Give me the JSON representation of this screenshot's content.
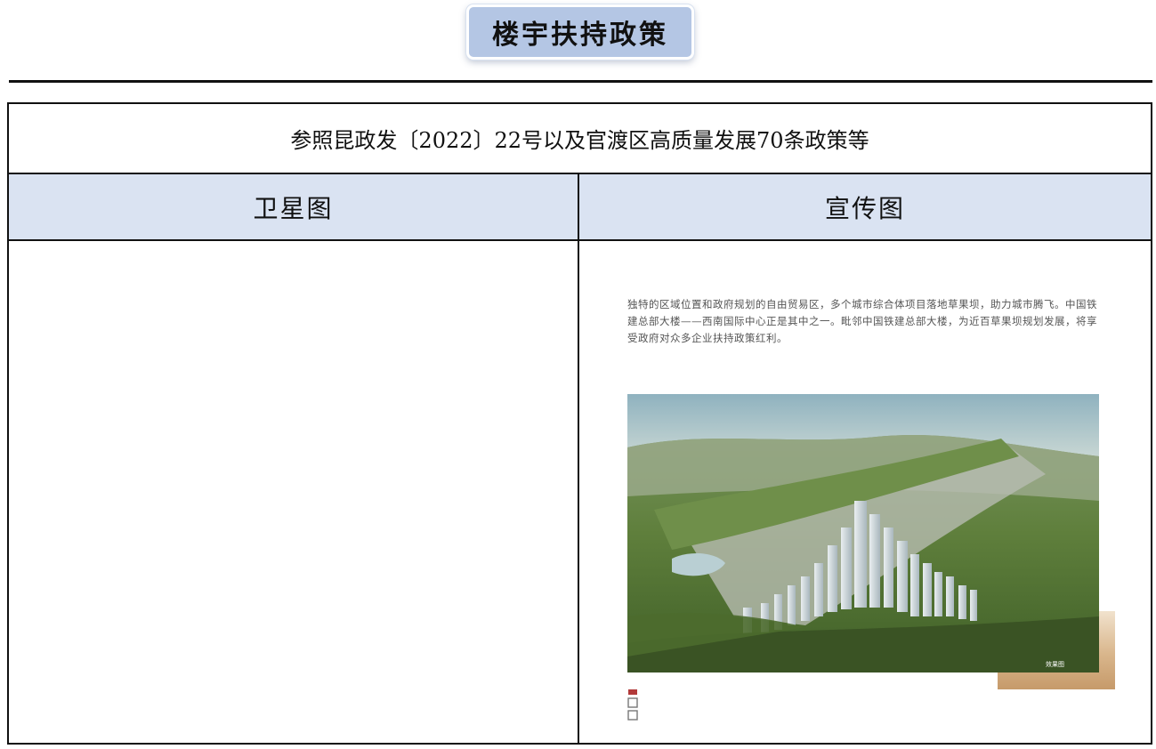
{
  "title": "楼宇扶持政策",
  "source_note": "参照昆政发〔2022〕22号以及官渡区高质量发展70条政策等",
  "columns": {
    "left_header": "卫星图",
    "right_header": "宣传图"
  },
  "promo_image": {
    "caption": "独特的区域位置和政府规划的自由贸易区，多个城市综合体项目落地草果坝，助力城市腾飞。中国铁建总部大楼——西南国际中心正是其中之一。毗邻中国铁建总部大楼，为近百草果坝规划发展，将享受政府对众多企业扶持政策红利。",
    "photo_alt": "城市鸟瞰效果图"
  }
}
